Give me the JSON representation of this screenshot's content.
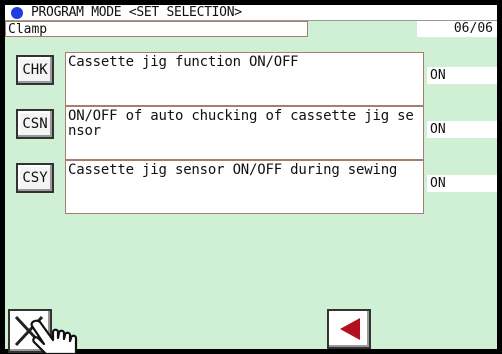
{
  "header": {
    "title": "PROGRAM MODE <SET SELECTION>",
    "category": "Clamp",
    "page": "06/06"
  },
  "settings": [
    {
      "code": "CHK",
      "description": "Cassette jig function ON/OFF",
      "value": "ON"
    },
    {
      "code": "CSN",
      "description": "ON/OFF of auto chucking of cassette jig sensor",
      "value": "ON"
    },
    {
      "code": "CSY",
      "description": "Cassette jig sensor ON/OFF during sewing",
      "value": "ON"
    }
  ],
  "icons": {
    "mode_indicator": "blue-dot-icon",
    "cancel": "close-x-icon",
    "back": "left-arrow-icon",
    "cursor": "hand-pointer-icon"
  },
  "colors": {
    "background": "#cff0d4",
    "indicator": "#1d3ee0",
    "back_arrow": "#b3101e",
    "border": "#a57f6e"
  }
}
